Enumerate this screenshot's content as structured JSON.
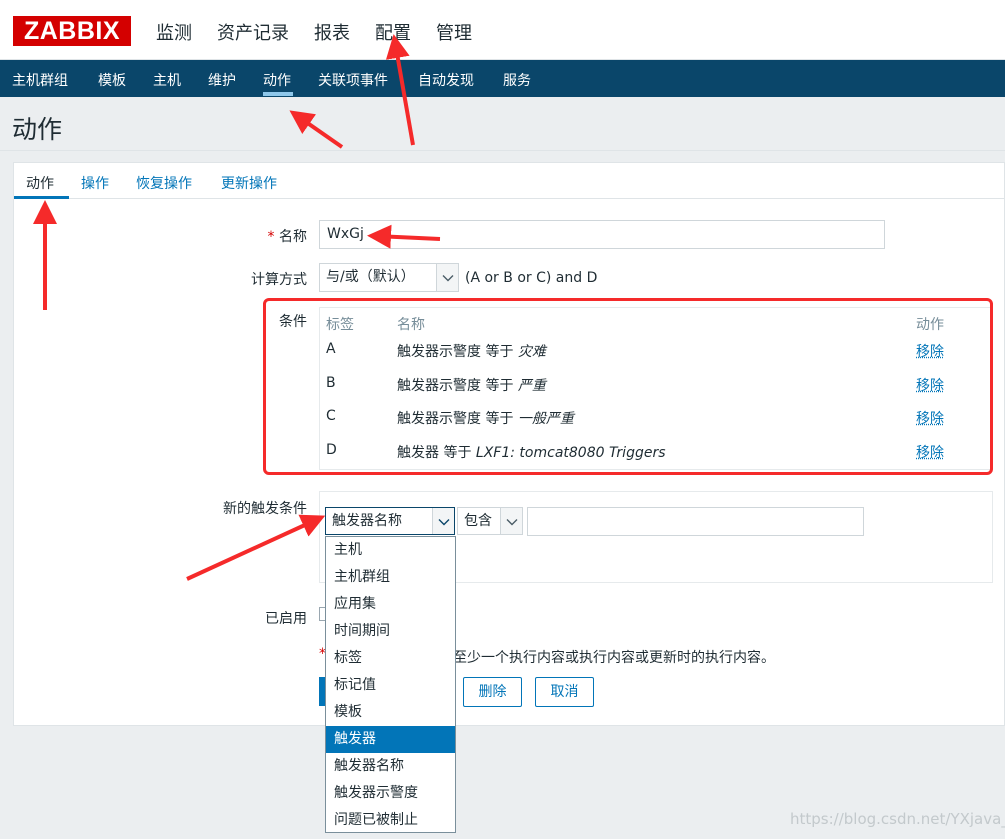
{
  "header": {
    "logo": "ZABBIX",
    "nav": [
      "监测",
      "资产记录",
      "报表",
      "配置",
      "管理"
    ]
  },
  "subnav": {
    "items": [
      "主机群组",
      "模板",
      "主机",
      "维护",
      "动作",
      "关联项事件",
      "自动发现",
      "服务"
    ],
    "active": "动作"
  },
  "page": {
    "title": "动作"
  },
  "tabs": [
    "动作",
    "操作",
    "恢复操作",
    "更新操作"
  ],
  "form": {
    "name_label": "名称",
    "name_required": "*",
    "name_value": "WxGj",
    "calc_label": "计算方式",
    "calc_value": "与/或（默认）",
    "calc_formula": "(A or B or C) and D",
    "conditions_label": "条件",
    "conditions_headers": {
      "label": "标签",
      "name": "名称",
      "action": "动作"
    },
    "conditions": [
      {
        "label": "A",
        "name_prefix": "触发器示警度 等于 ",
        "name_value": "灾难",
        "action": "移除"
      },
      {
        "label": "B",
        "name_prefix": "触发器示警度 等于 ",
        "name_value": "严重",
        "action": "移除"
      },
      {
        "label": "C",
        "name_prefix": "触发器示警度 等于 ",
        "name_value": "一般严重",
        "action": "移除"
      },
      {
        "label": "D",
        "name_prefix": "触发器 等于 ",
        "name_value": "LXF1: tomcat8080 Triggers",
        "action": "移除"
      }
    ],
    "new_condition_label": "新的触发条件",
    "new_condition_type": "触发器名称",
    "new_condition_operator": "包含",
    "new_condition_value": "",
    "enabled_label": "已启用",
    "note_star": "*",
    "note_text": "至少一个执行内容或执行内容或更新时的执行内容。",
    "buttons": {
      "delete": "删除",
      "cancel": "取消"
    }
  },
  "dropdown": {
    "options": [
      "主机",
      "主机群组",
      "应用集",
      "时间期间",
      "标签",
      "标记值",
      "模板",
      "触发器",
      "触发器名称",
      "触发器示警度",
      "问题已被制止"
    ],
    "highlighted": "触发器"
  },
  "watermark": "https://blog.csdn.net/YXjava_",
  "colors": {
    "brand_red": "#d40000",
    "subnav_bg": "#0a466a",
    "link": "#0275b8",
    "annotation_red": "#f52a2a"
  }
}
